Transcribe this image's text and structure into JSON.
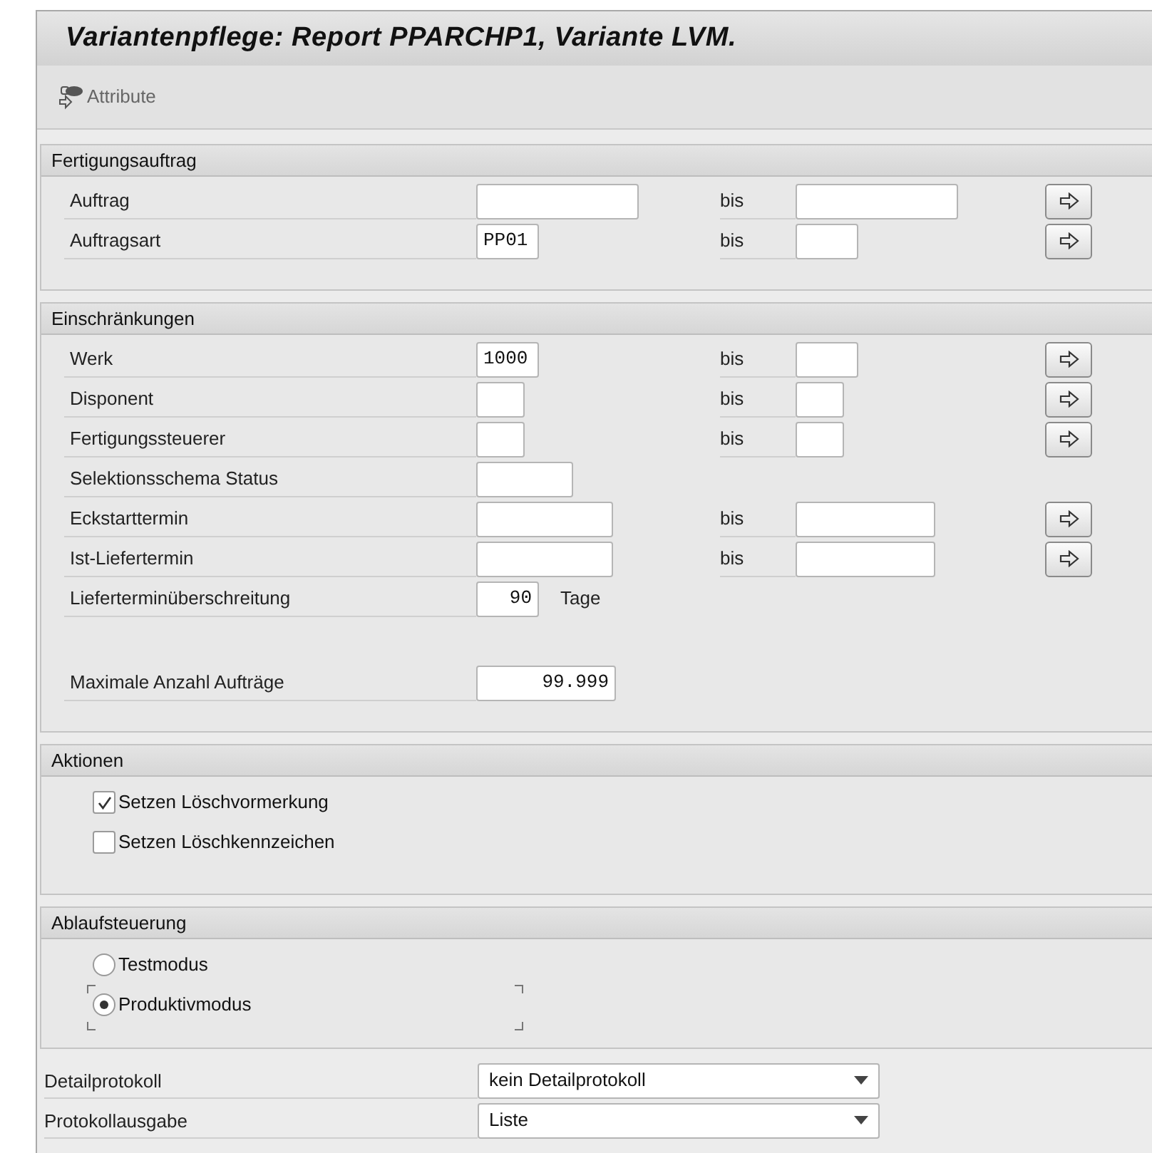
{
  "title": "Variantenpflege: Report PPARCHP1, Variante LVM.",
  "toolbar": [
    {
      "label": "Attribute"
    }
  ],
  "sections": [
    {
      "title": "Fertigungsauftrag",
      "kind": "fields",
      "rows": [
        {
          "label": "Auftrag",
          "range_label": "bis",
          "multiple_selection": true
        },
        {
          "label": "Auftragsart",
          "value": "PP01",
          "numeric": false,
          "range_label": "bis",
          "multiple_selection": true
        }
      ]
    },
    {
      "title": "Einschränkungen",
      "kind": "fields",
      "rows": [
        {
          "label": "Werk",
          "value": "1000",
          "numeric": false,
          "range_label": "bis",
          "multiple_selection": true
        },
        {
          "label": "Disponent",
          "range_label": "bis",
          "multiple_selection": true
        },
        {
          "label": "Fertigungssteuerer",
          "range_label": "bis",
          "multiple_selection": true
        },
        {
          "label": "Selektionsschema Status"
        },
        {
          "label": "Eckstarttermin",
          "range_label": "bis",
          "multiple_selection": true
        },
        {
          "label": "Ist-Liefertermin",
          "range_label": "bis",
          "multiple_selection": true
        },
        {
          "label": "Lieferterminüberschreitung",
          "value": "90",
          "numeric": true,
          "unit": "Tage"
        },
        {
          "kind": "spacer"
        },
        {
          "label": "Maximale Anzahl Aufträge",
          "value": "99.999",
          "numeric": true
        }
      ]
    },
    {
      "title": "Aktionen",
      "kind": "checkboxes",
      "items": [
        {
          "label": "Setzen Löschvormerkung",
          "checked": true
        },
        {
          "label": "Setzen Löschkennzeichen",
          "checked": false
        }
      ]
    },
    {
      "title": "Ablaufsteuerung",
      "kind": "radios",
      "items": [
        {
          "label": "Testmodus",
          "selected": false
        },
        {
          "label": "Produktivmodus",
          "selected": true
        }
      ]
    }
  ],
  "dropdowns": [
    {
      "label": "Detailprotokoll",
      "value": "kein Detailprotokoll"
    },
    {
      "label": "Protokollausgabe",
      "value": "Liste"
    }
  ]
}
